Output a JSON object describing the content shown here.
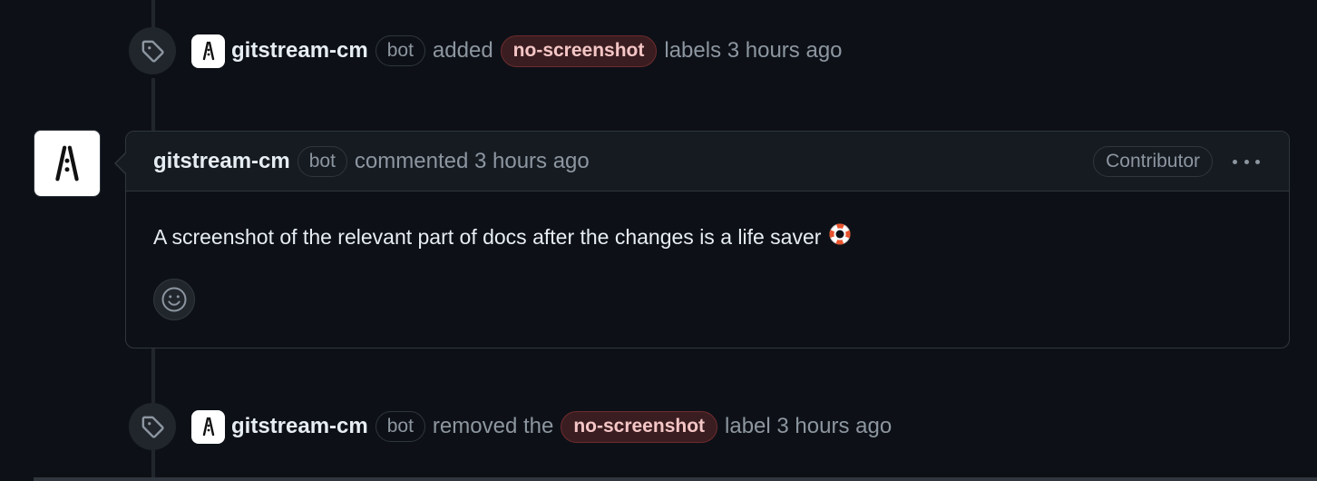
{
  "event_added": {
    "actor": "gitstream-cm",
    "bot_tag": "bot",
    "action": "added",
    "label": "no-screenshot",
    "suffix": "labels 3 hours ago",
    "icon": "tag-icon"
  },
  "comment": {
    "actor": "gitstream-cm",
    "bot_tag": "bot",
    "meta": "commented 3 hours ago",
    "role_badge": "Contributor",
    "body": "A screenshot of the relevant part of docs after the changes is a life saver",
    "body_emoji": "lifebuoy-icon",
    "reaction_icon": "smiley-icon",
    "menu_icon": "kebab-horizontal-icon"
  },
  "event_removed": {
    "actor": "gitstream-cm",
    "bot_tag": "bot",
    "action": "removed the",
    "label": "no-screenshot",
    "suffix": "label 3 hours ago",
    "icon": "tag-icon"
  },
  "colors": {
    "background": "#0d1117",
    "header_bg": "#161b22",
    "border": "#30363d",
    "muted_text": "#8d96a0",
    "label_bg": "#3a1d20",
    "label_border": "#6e2c2f"
  }
}
